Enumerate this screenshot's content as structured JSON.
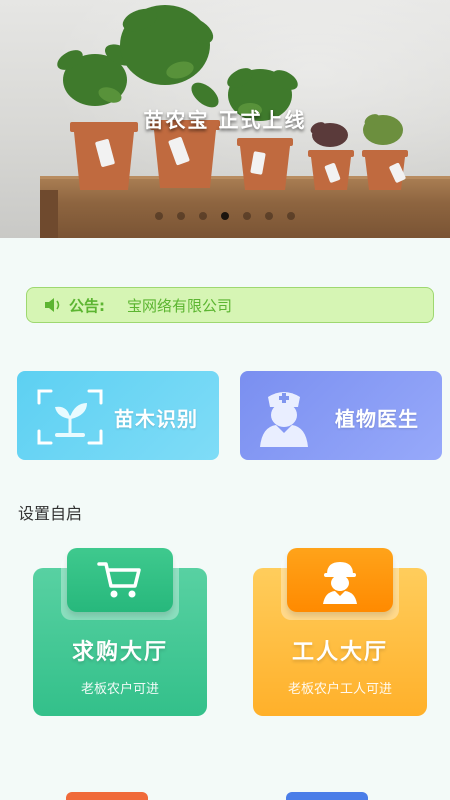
{
  "banner": {
    "title": "苗农宝 正式上线",
    "carousel_total": 7,
    "carousel_active_index": 3
  },
  "notice": {
    "icon": "speaker-icon",
    "label": "公告:",
    "text": "宝网络有限公司"
  },
  "features": [
    {
      "title": "苗木识别",
      "icon": "scan-seedling-icon"
    },
    {
      "title": "植物医生",
      "icon": "doctor-icon"
    }
  ],
  "section": {
    "title": "设置自启"
  },
  "halls": [
    {
      "title": "求购大厅",
      "subtitle": "老板农户可进",
      "icon": "cart-icon"
    },
    {
      "title": "工人大厅",
      "subtitle": "老板农户工人可进",
      "icon": "worker-icon"
    }
  ],
  "colors": {
    "notice_bg": "#d6f5b4",
    "notice_text": "#5cb531",
    "seedling_card": "#5dd0f2",
    "doctor_card": "#7a8ff0",
    "buy_hall": "#33c08a",
    "worker_hall": "#ffb02a"
  }
}
